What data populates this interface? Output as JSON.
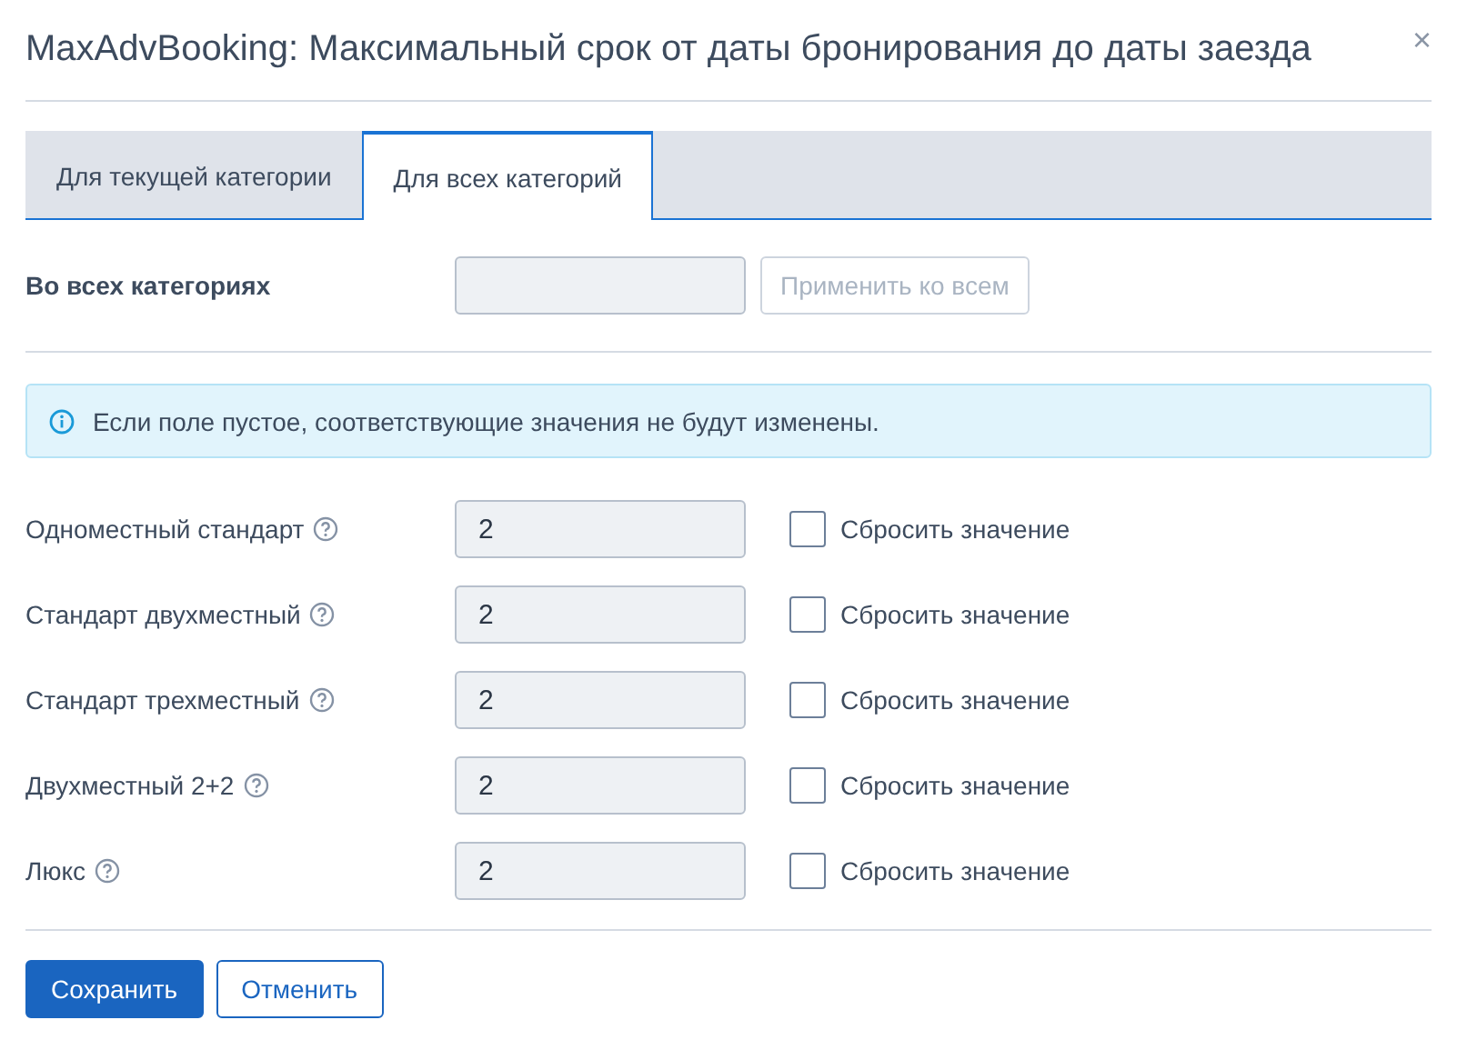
{
  "dialog": {
    "title": "MaxAdvBooking: Максимальный срок от даты бронирования до даты заезда",
    "close": "×"
  },
  "tabs": [
    {
      "label": "Для текущей категории",
      "selected": false
    },
    {
      "label": "Для всех категорий",
      "selected": true
    }
  ],
  "all_categories": {
    "label": "Во всех категориях",
    "apply_button": {
      "label": "Применить ко всем",
      "disabled": true
    }
  },
  "info": "Если поле пустое, соответствующие значения не будут изменены.",
  "rows": [
    {
      "name": "Одноместный стандарт",
      "value": "2",
      "reset_label": "Сбросить значение",
      "checked": false
    },
    {
      "name": "Стандарт двухместный",
      "value": "2",
      "reset_label": "Сбросить значение",
      "checked": false
    },
    {
      "name": "Стандарт трехместный",
      "value": "2",
      "reset_label": "Сбросить значение",
      "checked": false
    },
    {
      "name": "Двухместный 2+2",
      "value": "2",
      "reset_label": "Сбросить значение",
      "checked": false
    },
    {
      "name": "Люкс",
      "value": "2",
      "reset_label": "Сбросить значение",
      "checked": false
    }
  ],
  "buttons": {
    "save": "Сохранить",
    "cancel": "Отменить"
  }
}
